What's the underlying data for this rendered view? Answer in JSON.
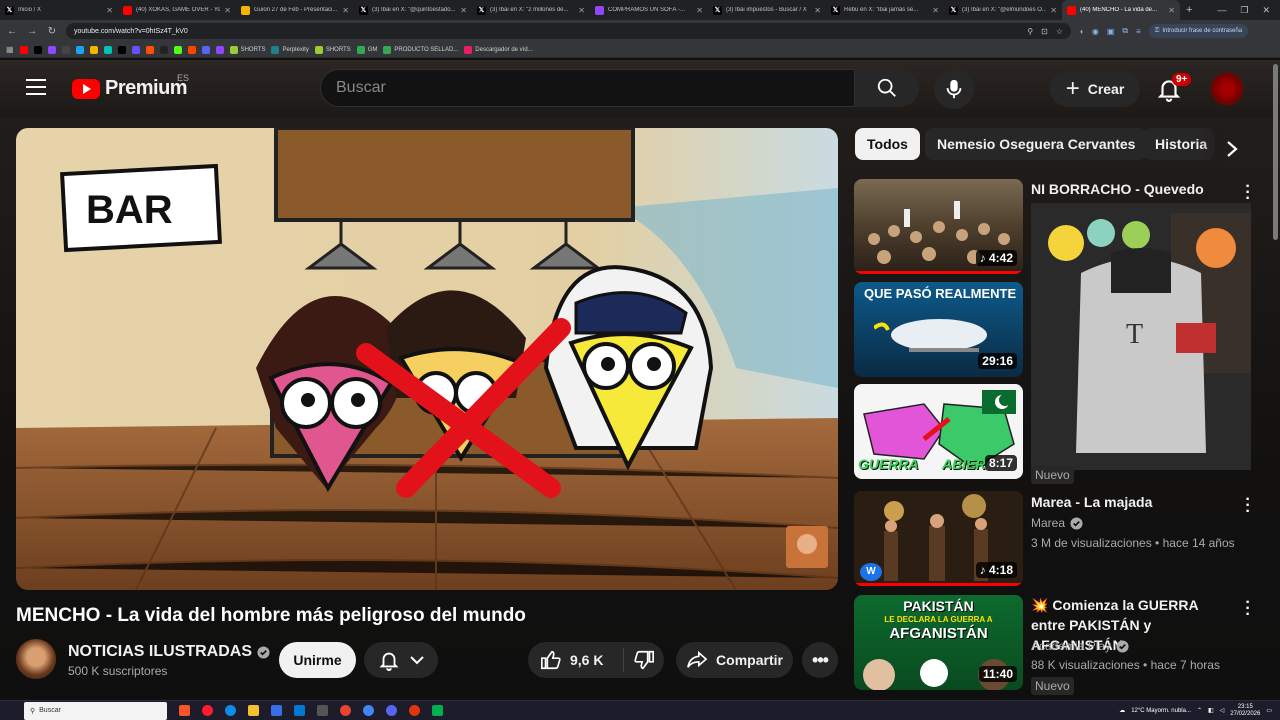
{
  "browser": {
    "tabs": [
      {
        "label": "Inicio / X",
        "icon": "x-icon",
        "color": "#000000"
      },
      {
        "label": "(40) XOKAS, GAME OVER - Yo...",
        "icon": "youtube-icon",
        "color": "#ff0000"
      },
      {
        "label": "Guion 27 de Feb - Presentaci...",
        "icon": "slides-icon",
        "color": "#f4b400"
      },
      {
        "label": "(3) Ibai en X: \"@quintoestado...",
        "icon": "x-icon",
        "color": "#000000"
      },
      {
        "label": "(3) Ibai en X: \"2 millones de...",
        "icon": "x-icon",
        "color": "#000000"
      },
      {
        "label": "COMPRAMOS UN SOFÁ -...",
        "icon": "twitch-icon",
        "color": "#9146ff"
      },
      {
        "label": "(3) Ibai impuestos - Buscar / X",
        "icon": "x-icon",
        "color": "#000000"
      },
      {
        "label": "Rebu en X: \"Ibai jamás se...",
        "icon": "x-icon",
        "color": "#000000"
      },
      {
        "label": "(3) Ibai en X: \"@elmundoes O...",
        "icon": "x-icon",
        "color": "#000000"
      },
      {
        "label": "(40) MENCHO - La vida de...",
        "icon": "youtube-icon",
        "color": "#ff0000",
        "active": true
      }
    ],
    "url": "youtube.com/watch?v=0htSz4T_kV0",
    "password_prompt": "Introducir frase de contraseña",
    "bookmarks": [
      {
        "label": "",
        "color": "#ff0000"
      },
      {
        "label": "",
        "color": "#000000"
      },
      {
        "label": "",
        "color": "#9146ff"
      },
      {
        "label": "",
        "color": "#444444"
      },
      {
        "label": "",
        "color": "#1da1f2"
      },
      {
        "label": "",
        "color": "#f4b400"
      },
      {
        "label": "",
        "color": "#00c4b4"
      },
      {
        "label": "",
        "color": "#000000"
      },
      {
        "label": "",
        "color": "#6b4cff"
      },
      {
        "label": "",
        "color": "#ff5000"
      },
      {
        "label": "",
        "color": "#222222"
      },
      {
        "label": "",
        "color": "#53fc18"
      },
      {
        "label": "",
        "color": "#ff4500"
      },
      {
        "label": "",
        "color": "#5865f2"
      },
      {
        "label": "",
        "color": "#9146ff"
      },
      {
        "label": "SHORTS",
        "color": "#9acd32"
      },
      {
        "label": "Perplexity",
        "color": "#20808d"
      },
      {
        "label": "SHORTS",
        "color": "#9acd32"
      },
      {
        "label": "GM",
        "color": "#34a853"
      },
      {
        "label": "PRODUCTO SELLAD...",
        "color": "#34a853"
      },
      {
        "label": "Descargador de víd...",
        "color": "#e91e63"
      }
    ]
  },
  "header": {
    "logo_text": "Premium",
    "region": "ES",
    "search_placeholder": "Buscar",
    "create_label": "Crear",
    "notif_badge": "9+"
  },
  "video": {
    "title": "MENCHO - La vida del hombre más peligroso del mundo",
    "thumb_sign": "BAR",
    "channel": "NOTICIAS ILUSTRADAS",
    "subscribers": "500 K suscriptores",
    "join_label": "Unirme",
    "likes": "9,6 K",
    "share_label": "Compartir"
  },
  "chips": [
    "Todos",
    "Nemesio Oseguera Cervantes",
    "Historia"
  ],
  "related": [
    {
      "duration": "4:42",
      "music": true
    },
    {
      "duration": "29:16",
      "thumb_text": "QUE PASÓ REALMENTE"
    },
    {
      "duration": "8:17",
      "thumb_text_left": "GUERRA",
      "thumb_text_right": "ABIER"
    },
    {
      "title": "Marea - La majada",
      "channel": "Marea",
      "meta": "3 M de visualizaciones • hace 14 años",
      "duration": "4:18",
      "music": true
    },
    {
      "title": "Comienza la GUERRA entre PAKISTÁN y AFGANISTÁN",
      "title_prefix": "💥",
      "channel": "Academia Play",
      "meta": "88 K visualizaciones • hace 7 horas",
      "duration": "11:40",
      "badge": "Nuevo",
      "thumb_text": "PAKISTÁN",
      "thumb_sub": "LE DECLARA LA GUERRA A",
      "thumb_text2": "AFGANISTÁN"
    }
  ],
  "mix_card": {
    "title": "NI BORRACHO - Quevedo",
    "badge": "Nuevo"
  },
  "taskbar": {
    "search_placeholder": "Buscar",
    "weather": "12°C  Mayorm. nubla...",
    "time": "23:15",
    "date": "27/02/2026"
  }
}
